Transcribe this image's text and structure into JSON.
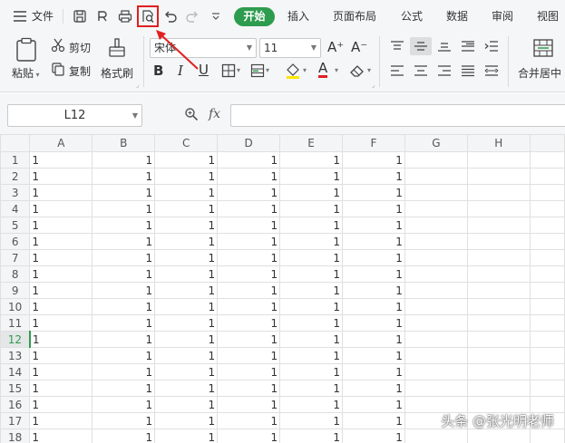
{
  "menubar": {
    "menu_label": "文件",
    "start_tab": "开始",
    "tabs": [
      "插入",
      "页面布局",
      "公式",
      "数据",
      "审阅",
      "视图"
    ]
  },
  "ribbon": {
    "paste": "粘贴",
    "cut": "剪切",
    "copy": "复制",
    "format_painter": "格式刷",
    "font_name": "宋体",
    "font_size": "11",
    "grow_font": "A⁺",
    "shrink_font": "A⁻",
    "bold": "B",
    "italic": "I",
    "underline": "U",
    "font_color_letter": "A",
    "merge_center": "合并居中"
  },
  "formula_bar": {
    "name_box": "L12",
    "fx": "fx",
    "formula": ""
  },
  "sheet": {
    "columns": [
      "A",
      "B",
      "C",
      "D",
      "E",
      "F",
      "G",
      "H"
    ],
    "rows": [
      {
        "n": "1",
        "cells": [
          "1",
          "1",
          "1",
          "1",
          "1",
          "1"
        ]
      },
      {
        "n": "2",
        "cells": [
          "1",
          "1",
          "1",
          "1",
          "1",
          "1"
        ]
      },
      {
        "n": "3",
        "cells": [
          "1",
          "1",
          "1",
          "1",
          "1",
          "1"
        ]
      },
      {
        "n": "4",
        "cells": [
          "1",
          "1",
          "1",
          "1",
          "1",
          "1"
        ]
      },
      {
        "n": "5",
        "cells": [
          "1",
          "1",
          "1",
          "1",
          "1",
          "1"
        ]
      },
      {
        "n": "6",
        "cells": [
          "1",
          "1",
          "1",
          "1",
          "1",
          "1"
        ]
      },
      {
        "n": "7",
        "cells": [
          "1",
          "1",
          "1",
          "1",
          "1",
          "1"
        ]
      },
      {
        "n": "8",
        "cells": [
          "1",
          "1",
          "1",
          "1",
          "1",
          "1"
        ]
      },
      {
        "n": "9",
        "cells": [
          "1",
          "1",
          "1",
          "1",
          "1",
          "1"
        ]
      },
      {
        "n": "10",
        "cells": [
          "1",
          "1",
          "1",
          "1",
          "1",
          "1"
        ]
      },
      {
        "n": "11",
        "cells": [
          "1",
          "1",
          "1",
          "1",
          "1",
          "1"
        ]
      },
      {
        "n": "12",
        "cells": [
          "1",
          "1",
          "1",
          "1",
          "1",
          "1"
        ]
      },
      {
        "n": "13",
        "cells": [
          "1",
          "1",
          "1",
          "1",
          "1",
          "1"
        ]
      },
      {
        "n": "14",
        "cells": [
          "1",
          "1",
          "1",
          "1",
          "1",
          "1"
        ]
      },
      {
        "n": "15",
        "cells": [
          "1",
          "1",
          "1",
          "1",
          "1",
          "1"
        ]
      },
      {
        "n": "16",
        "cells": [
          "1",
          "1",
          "1",
          "1",
          "1",
          "1"
        ]
      },
      {
        "n": "17",
        "cells": [
          "1",
          "1",
          "1",
          "1",
          "1",
          "1"
        ]
      },
      {
        "n": "18",
        "cells": [
          "1",
          "1",
          "1",
          "1",
          "1",
          "1"
        ]
      }
    ],
    "active_row": "12"
  },
  "watermark": "头条 @张光明老师",
  "colors": {
    "accent_green": "#2e9c4e",
    "highlight_red": "#e02020"
  }
}
